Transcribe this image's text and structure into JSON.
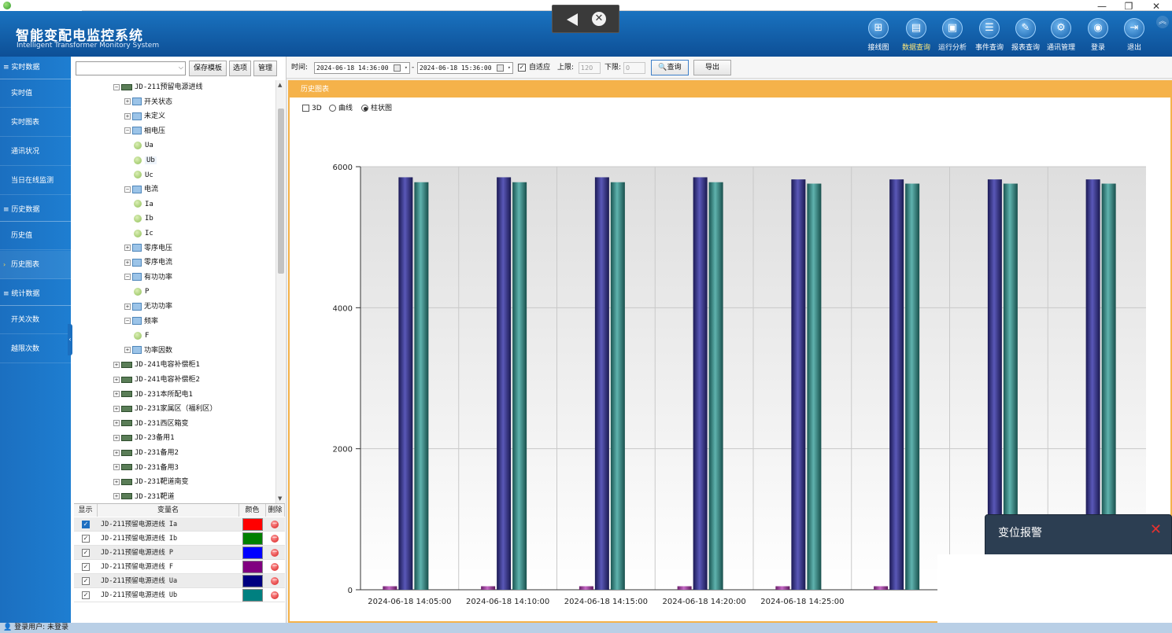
{
  "app": {
    "title": "智能变配电监控系统",
    "subtitle": "Intelligent Transformer Monitory System"
  },
  "window_controls": {
    "minimize": "—",
    "restore": "❐",
    "close": "✕"
  },
  "top_nav": [
    {
      "label": "接线图",
      "icon": "diagram-icon",
      "glyph": "⊞"
    },
    {
      "label": "数据查询",
      "icon": "data-query-icon",
      "glyph": "▤",
      "active": true
    },
    {
      "label": "运行分析",
      "icon": "analysis-icon",
      "glyph": "▣"
    },
    {
      "label": "事件查询",
      "icon": "event-icon",
      "glyph": "☰"
    },
    {
      "label": "报表查询",
      "icon": "report-icon",
      "glyph": "✎"
    },
    {
      "label": "通讯管理",
      "icon": "comm-icon",
      "glyph": "⚙"
    },
    {
      "label": "登录",
      "icon": "login-icon",
      "glyph": "◉"
    },
    {
      "label": "退出",
      "icon": "exit-icon",
      "glyph": "⇥"
    }
  ],
  "sidebar": {
    "groups": [
      {
        "label": "≡ 实时数据",
        "items": [
          "实时值",
          "实时图表",
          "通讯状况",
          "当日在线监测"
        ]
      },
      {
        "label": "≡ 历史数据",
        "items": [
          "历史值",
          "历史图表"
        ]
      },
      {
        "label": "≡ 统计数据",
        "items": [
          "开关次数",
          "越限次数"
        ]
      }
    ],
    "selected": "历史图表"
  },
  "left_toolbar": {
    "template_value": "",
    "save_template": "保存模板",
    "options": "选项",
    "manage": "管理"
  },
  "tree": [
    {
      "level": 0,
      "type": "device",
      "expanded": true,
      "label": "JD-211预留电源进线"
    },
    {
      "level": 1,
      "type": "folder",
      "expanded": false,
      "label": "开关状态"
    },
    {
      "level": 1,
      "type": "folder",
      "expanded": false,
      "label": "未定义"
    },
    {
      "level": 1,
      "type": "folder",
      "expanded": true,
      "label": "相电压"
    },
    {
      "level": 2,
      "type": "leaf",
      "label": "Ua"
    },
    {
      "level": 2,
      "type": "leaf",
      "label": "Ub",
      "highlight": true
    },
    {
      "level": 2,
      "type": "leaf",
      "label": "Uc"
    },
    {
      "level": 1,
      "type": "folder",
      "expanded": true,
      "label": "电流"
    },
    {
      "level": 2,
      "type": "leaf",
      "label": "Ia"
    },
    {
      "level": 2,
      "type": "leaf",
      "label": "Ib"
    },
    {
      "level": 2,
      "type": "leaf",
      "label": "Ic"
    },
    {
      "level": 1,
      "type": "folder",
      "expanded": false,
      "label": "零序电压"
    },
    {
      "level": 1,
      "type": "folder",
      "expanded": false,
      "label": "零序电流"
    },
    {
      "level": 1,
      "type": "folder",
      "expanded": true,
      "label": "有功功率"
    },
    {
      "level": 2,
      "type": "leaf",
      "label": "P"
    },
    {
      "level": 1,
      "type": "folder",
      "expanded": false,
      "label": "无功功率"
    },
    {
      "level": 1,
      "type": "folder",
      "expanded": true,
      "label": "频率"
    },
    {
      "level": 2,
      "type": "leaf",
      "label": "F"
    },
    {
      "level": 1,
      "type": "folder",
      "expanded": false,
      "label": "功率因数"
    },
    {
      "level": 0,
      "type": "device",
      "expanded": false,
      "label": "JD-241电容补偿柜1"
    },
    {
      "level": 0,
      "type": "device",
      "expanded": false,
      "label": "JD-241电容补偿柜2"
    },
    {
      "level": 0,
      "type": "device",
      "expanded": false,
      "label": "JD-231本所配电1"
    },
    {
      "level": 0,
      "type": "device",
      "expanded": false,
      "label": "JD-231家属区（福利区）"
    },
    {
      "level": 0,
      "type": "device",
      "expanded": false,
      "label": "JD-231西区箱变"
    },
    {
      "level": 0,
      "type": "device",
      "expanded": false,
      "label": "JD-23备用1"
    },
    {
      "level": 0,
      "type": "device",
      "expanded": false,
      "label": "JD-231备用2"
    },
    {
      "level": 0,
      "type": "device",
      "expanded": false,
      "label": "JD-231备用3"
    },
    {
      "level": 0,
      "type": "device",
      "expanded": false,
      "label": "JD-231靶道南变"
    },
    {
      "level": 0,
      "type": "device",
      "expanded": false,
      "label": "JD-231靶道"
    }
  ],
  "var_table": {
    "headers": [
      "显示",
      "变量名",
      "颜色",
      "删除"
    ],
    "rows": [
      {
        "checked": true,
        "name": "JD-211预留电源进线 Ia",
        "color": "#ff0000"
      },
      {
        "checked": true,
        "name": "JD-211预留电源进线 Ib",
        "color": "#008000"
      },
      {
        "checked": true,
        "name": "JD-211预留电源进线 P",
        "color": "#0000ff"
      },
      {
        "checked": true,
        "name": "JD-211预留电源进线 F",
        "color": "#800080"
      },
      {
        "checked": true,
        "name": "JD-211预留电源进线 Ua",
        "color": "#000080"
      },
      {
        "checked": true,
        "name": "JD-211预留电源进线 Ub",
        "color": "#008080"
      }
    ]
  },
  "query_bar": {
    "time_label": "时间:",
    "start": "2024-06-18 14:36:00",
    "separator": "-",
    "end": "2024-06-18 15:36:00",
    "auto_label": "自适应",
    "auto_checked": true,
    "upper_label": "上限:",
    "upper_value": "120",
    "lower_label": "下限:",
    "lower_value": "0",
    "query_button": "查询",
    "export_button": "导出"
  },
  "panel": {
    "title": "历史图表",
    "opt_3d": "3D",
    "opt_curve": "曲线",
    "opt_bar": "柱状图",
    "mode": "bar"
  },
  "chart_data": {
    "type": "bar",
    "categories": [
      "2024-06-18 14:05:00",
      "2024-06-18 14:10:00",
      "2024-06-18 14:15:00",
      "2024-06-18 14:20:00",
      "2024-06-18 14:25:00",
      "",
      "",
      ""
    ],
    "series": [
      {
        "color": "#9a3a9a",
        "values": [
          50,
          50,
          50,
          50,
          50,
          50,
          50,
          50
        ]
      },
      {
        "color": "#2b2a7a",
        "values": [
          5850,
          5850,
          5850,
          5850,
          5820,
          5820,
          5820,
          5820
        ]
      },
      {
        "color": "#2a7b78",
        "values": [
          5780,
          5780,
          5780,
          5780,
          5760,
          5760,
          5760,
          5760
        ]
      }
    ],
    "yticks": [
      0,
      2000,
      4000,
      6000
    ],
    "ylim": [
      0,
      6000
    ],
    "grid": true
  },
  "alarm": {
    "title": "变位报警",
    "close": "✕"
  },
  "status": {
    "text": "登录用户: 未登录"
  }
}
